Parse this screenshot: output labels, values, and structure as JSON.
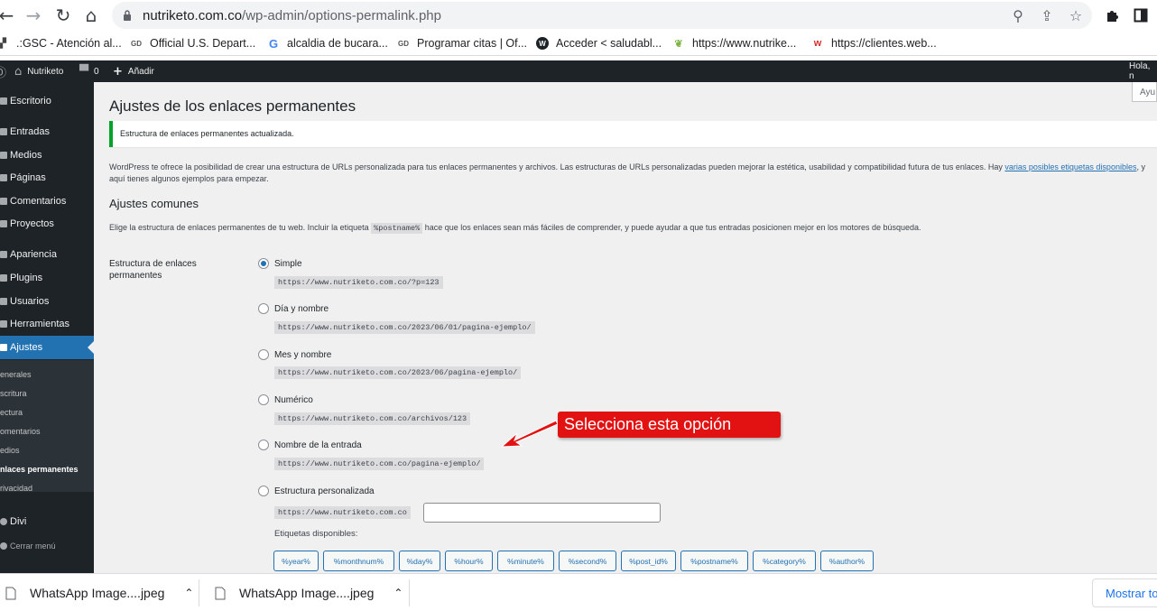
{
  "browser": {
    "url_host": "nutriketo.com.co",
    "url_path": "/wp-admin/options-permalink.php",
    "bookmarks": [
      {
        "label": ".:GSC - Atención al...",
        "icon": "gsc-favicon"
      },
      {
        "label": "Official U.S. Depart...",
        "icon": "gov-favicon"
      },
      {
        "label": "alcaldia de bucara...",
        "icon": "google-favicon"
      },
      {
        "label": "Programar citas | Of...",
        "icon": "gov-favicon"
      },
      {
        "label": "Acceder < saludabl...",
        "icon": "wordpress-favicon"
      },
      {
        "label": "https://www.nutrike...",
        "icon": "leaf-favicon"
      },
      {
        "label": "https://clientes.web...",
        "icon": "web-favicon"
      }
    ]
  },
  "adminbar": {
    "site_name": "Nutriketo",
    "comments_count": "0",
    "add_new": "Añadir",
    "greeting": "Hola, n"
  },
  "sidebar": {
    "items": [
      "Escritorio",
      "Entradas",
      "Medios",
      "Páginas",
      "Comentarios",
      "Proyectos",
      "Apariencia",
      "Plugins",
      "Usuarios",
      "Herramientas",
      "Ajustes"
    ],
    "submenu": [
      "enerales",
      "scritura",
      "ectura",
      "omentarios",
      "edios",
      "nlaces permanentes",
      "rivacidad"
    ],
    "divi": "Divi",
    "collapse": "Cerrar menú"
  },
  "main": {
    "help_tab": "Ayu",
    "title": "Ajustes de los enlaces permanentes",
    "notice": "Estructura de enlaces permanentes actualizada.",
    "intro_text": "WordPress te ofrece la posibilidad de crear una estructura de URLs personalizada para tus enlaces permanentes y archivos. Las estructuras de URLs personalizadas pueden mejorar la estética, usabilidad y compatibilidad futura de tus enlaces. Hay ",
    "intro_link": "varias posibles etiquetas disponibles",
    "intro_tail": ", y aquí tienes algunos ejemplos para empezar.",
    "section_title": "Ajustes comunes",
    "desc_before": "Elige la estructura de enlaces permanentes de tu web. Incluir la etiqueta ",
    "desc_code": "%postname%",
    "desc_after": " hace que los enlaces sean más fáciles de comprender, y puede ayudar a que tus entradas posicionen mejor en los motores de búsqueda.",
    "row_label": "Estructura de enlaces permanentes",
    "options": [
      {
        "label": "Simple",
        "sample": "https://www.nutriketo.com.co/?p=123",
        "checked": true
      },
      {
        "label": "Día y nombre",
        "sample": "https://www.nutriketo.com.co/2023/06/01/pagina-ejemplo/",
        "checked": false
      },
      {
        "label": "Mes y nombre",
        "sample": "https://www.nutriketo.com.co/2023/06/pagina-ejemplo/",
        "checked": false
      },
      {
        "label": "Numérico",
        "sample": "https://www.nutriketo.com.co/archivos/123",
        "checked": false
      },
      {
        "label": "Nombre de la entrada",
        "sample": "https://www.nutriketo.com.co/pagina-ejemplo/",
        "checked": false
      },
      {
        "label": "Estructura personalizada",
        "sample": "https://www.nutriketo.com.co",
        "checked": false
      }
    ],
    "custom_value": "",
    "tags_label": "Etiquetas disponibles:",
    "tags": [
      "%year%",
      "%monthnum%",
      "%day%",
      "%hour%",
      "%minute%",
      "%second%",
      "%post_id%",
      "%postname%",
      "%category%",
      "%author%"
    ]
  },
  "annotation": {
    "text": "Selecciona esta opción",
    "color": "#e31212"
  },
  "downloads": {
    "items": [
      "WhatsApp Image....jpeg",
      "WhatsApp Image....jpeg"
    ],
    "show_all": "Mostrar to"
  }
}
